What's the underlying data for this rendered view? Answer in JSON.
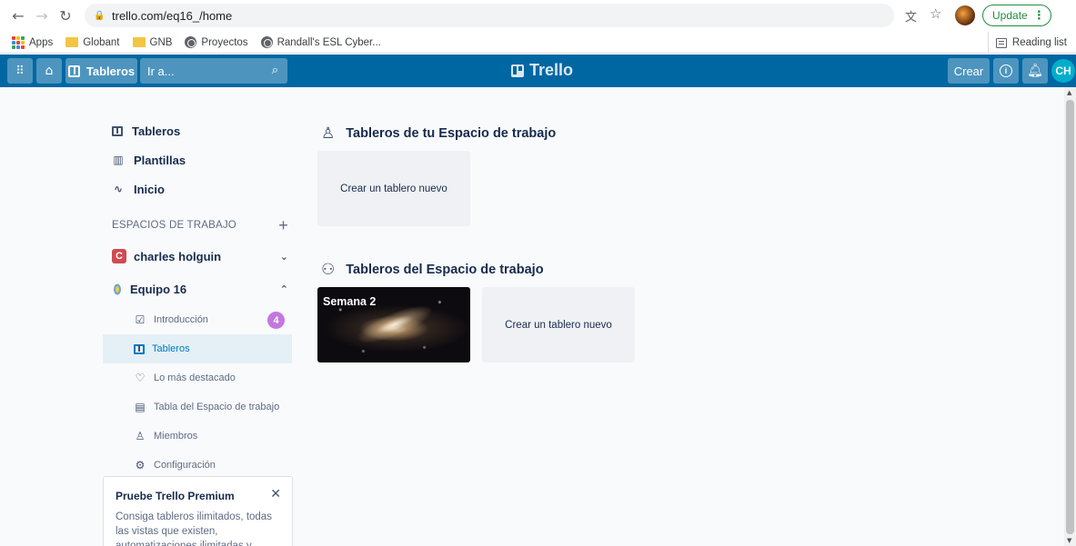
{
  "browser": {
    "url": "trello.com/eq16_/home",
    "update_label": "Update",
    "bookmarks": [
      {
        "label": "Apps",
        "icon": "apps-grid-icon"
      },
      {
        "label": "Globant",
        "icon": "folder-icon"
      },
      {
        "label": "GNB",
        "icon": "folder-icon"
      },
      {
        "label": "Proyectos",
        "icon": "globe-icon"
      },
      {
        "label": "Randall's ESL Cyber...",
        "icon": "globe-icon"
      }
    ],
    "reading_list": "Reading list"
  },
  "header": {
    "boards_label": "Tableros",
    "search_placeholder": "Ir a...",
    "logo": "Trello",
    "create_label": "Crear",
    "user_initials": "CH",
    "bg_color": "#0067a3"
  },
  "sidebar": {
    "main_items": [
      {
        "label": "Tableros",
        "icon": "board-icon"
      },
      {
        "label": "Plantillas",
        "icon": "template-icon"
      },
      {
        "label": "Inicio",
        "icon": "pulse-icon"
      }
    ],
    "workspaces_title": "ESPACIOS DE TRABAJO",
    "workspaces": [
      {
        "label": "charles holguin",
        "badge": "C",
        "badge_color": "#d04a52",
        "expanded": false
      },
      {
        "label": "Equipo 16",
        "expanded": true
      }
    ],
    "sub_items": [
      {
        "label": "Introducción",
        "icon": "checklist-icon",
        "badge": "4"
      },
      {
        "label": "Tableros",
        "icon": "board-icon",
        "active": true
      },
      {
        "label": "Lo más destacado",
        "icon": "heart-icon"
      },
      {
        "label": "Tabla del Espacio de trabajo",
        "icon": "table-icon"
      },
      {
        "label": "Miembros",
        "icon": "members-icon"
      },
      {
        "label": "Configuración",
        "icon": "gear-icon"
      }
    ],
    "premium": {
      "title": "Pruebe Trello Premium",
      "text": "Consiga tableros ilimitados, todas las vistas que existen, automatizaciones ilimitadas y mucho más."
    }
  },
  "main": {
    "your_boards_title": "Tableros de tu Espacio de trabajo",
    "create_board_label": "Crear un tablero nuevo",
    "workspace_boards_title": "Tableros del Espacio de trabajo",
    "boards": [
      {
        "name": "Semana 2"
      }
    ]
  }
}
